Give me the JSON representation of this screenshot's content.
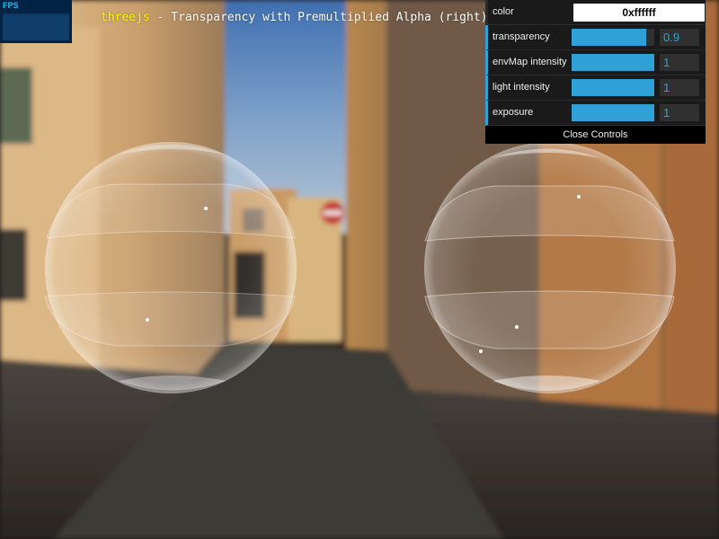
{
  "fps": {
    "label": "FPS"
  },
  "title": {
    "link": "threejs",
    "text": " - Transparency with Premultiplied Alpha (right)"
  },
  "gui": {
    "color": {
      "label": "color",
      "value": "0xffffff"
    },
    "transparency": {
      "label": "transparency",
      "value": "0.9",
      "fill": 0.9
    },
    "envmap_intensity": {
      "label": "envMap intensity",
      "value": "1",
      "fill": 1.0
    },
    "light_intensity": {
      "label": "light intensity",
      "value": "1",
      "fill": 1.0
    },
    "exposure": {
      "label": "exposure",
      "value": "1",
      "fill": 1.0
    },
    "close_label": "Close Controls"
  },
  "colors": {
    "accent": "#2fa1d6",
    "panel_bg": "#1a1a1a",
    "title_link": "#ffff00"
  }
}
